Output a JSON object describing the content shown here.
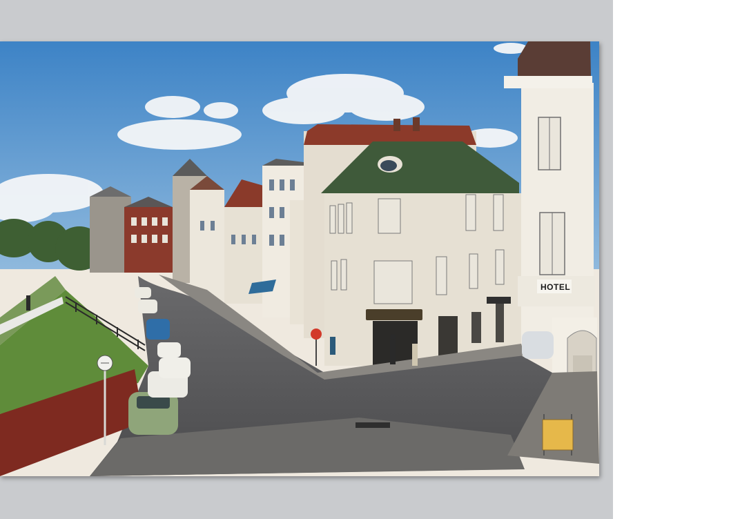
{
  "scene": {
    "description_type": "vintage color postcard photograph of a town street",
    "signs": {
      "hotel": "HOTEL"
    },
    "colors": {
      "sky": "#4f8fcf",
      "grass": "#5f8c3a",
      "road": "#58585a",
      "wall": "#8a2e22",
      "facade": "#e3ddcf",
      "roof_green": "#3f5a3a",
      "roof_red": "#8c3a2a",
      "scan_background": "#c9cbce"
    }
  }
}
